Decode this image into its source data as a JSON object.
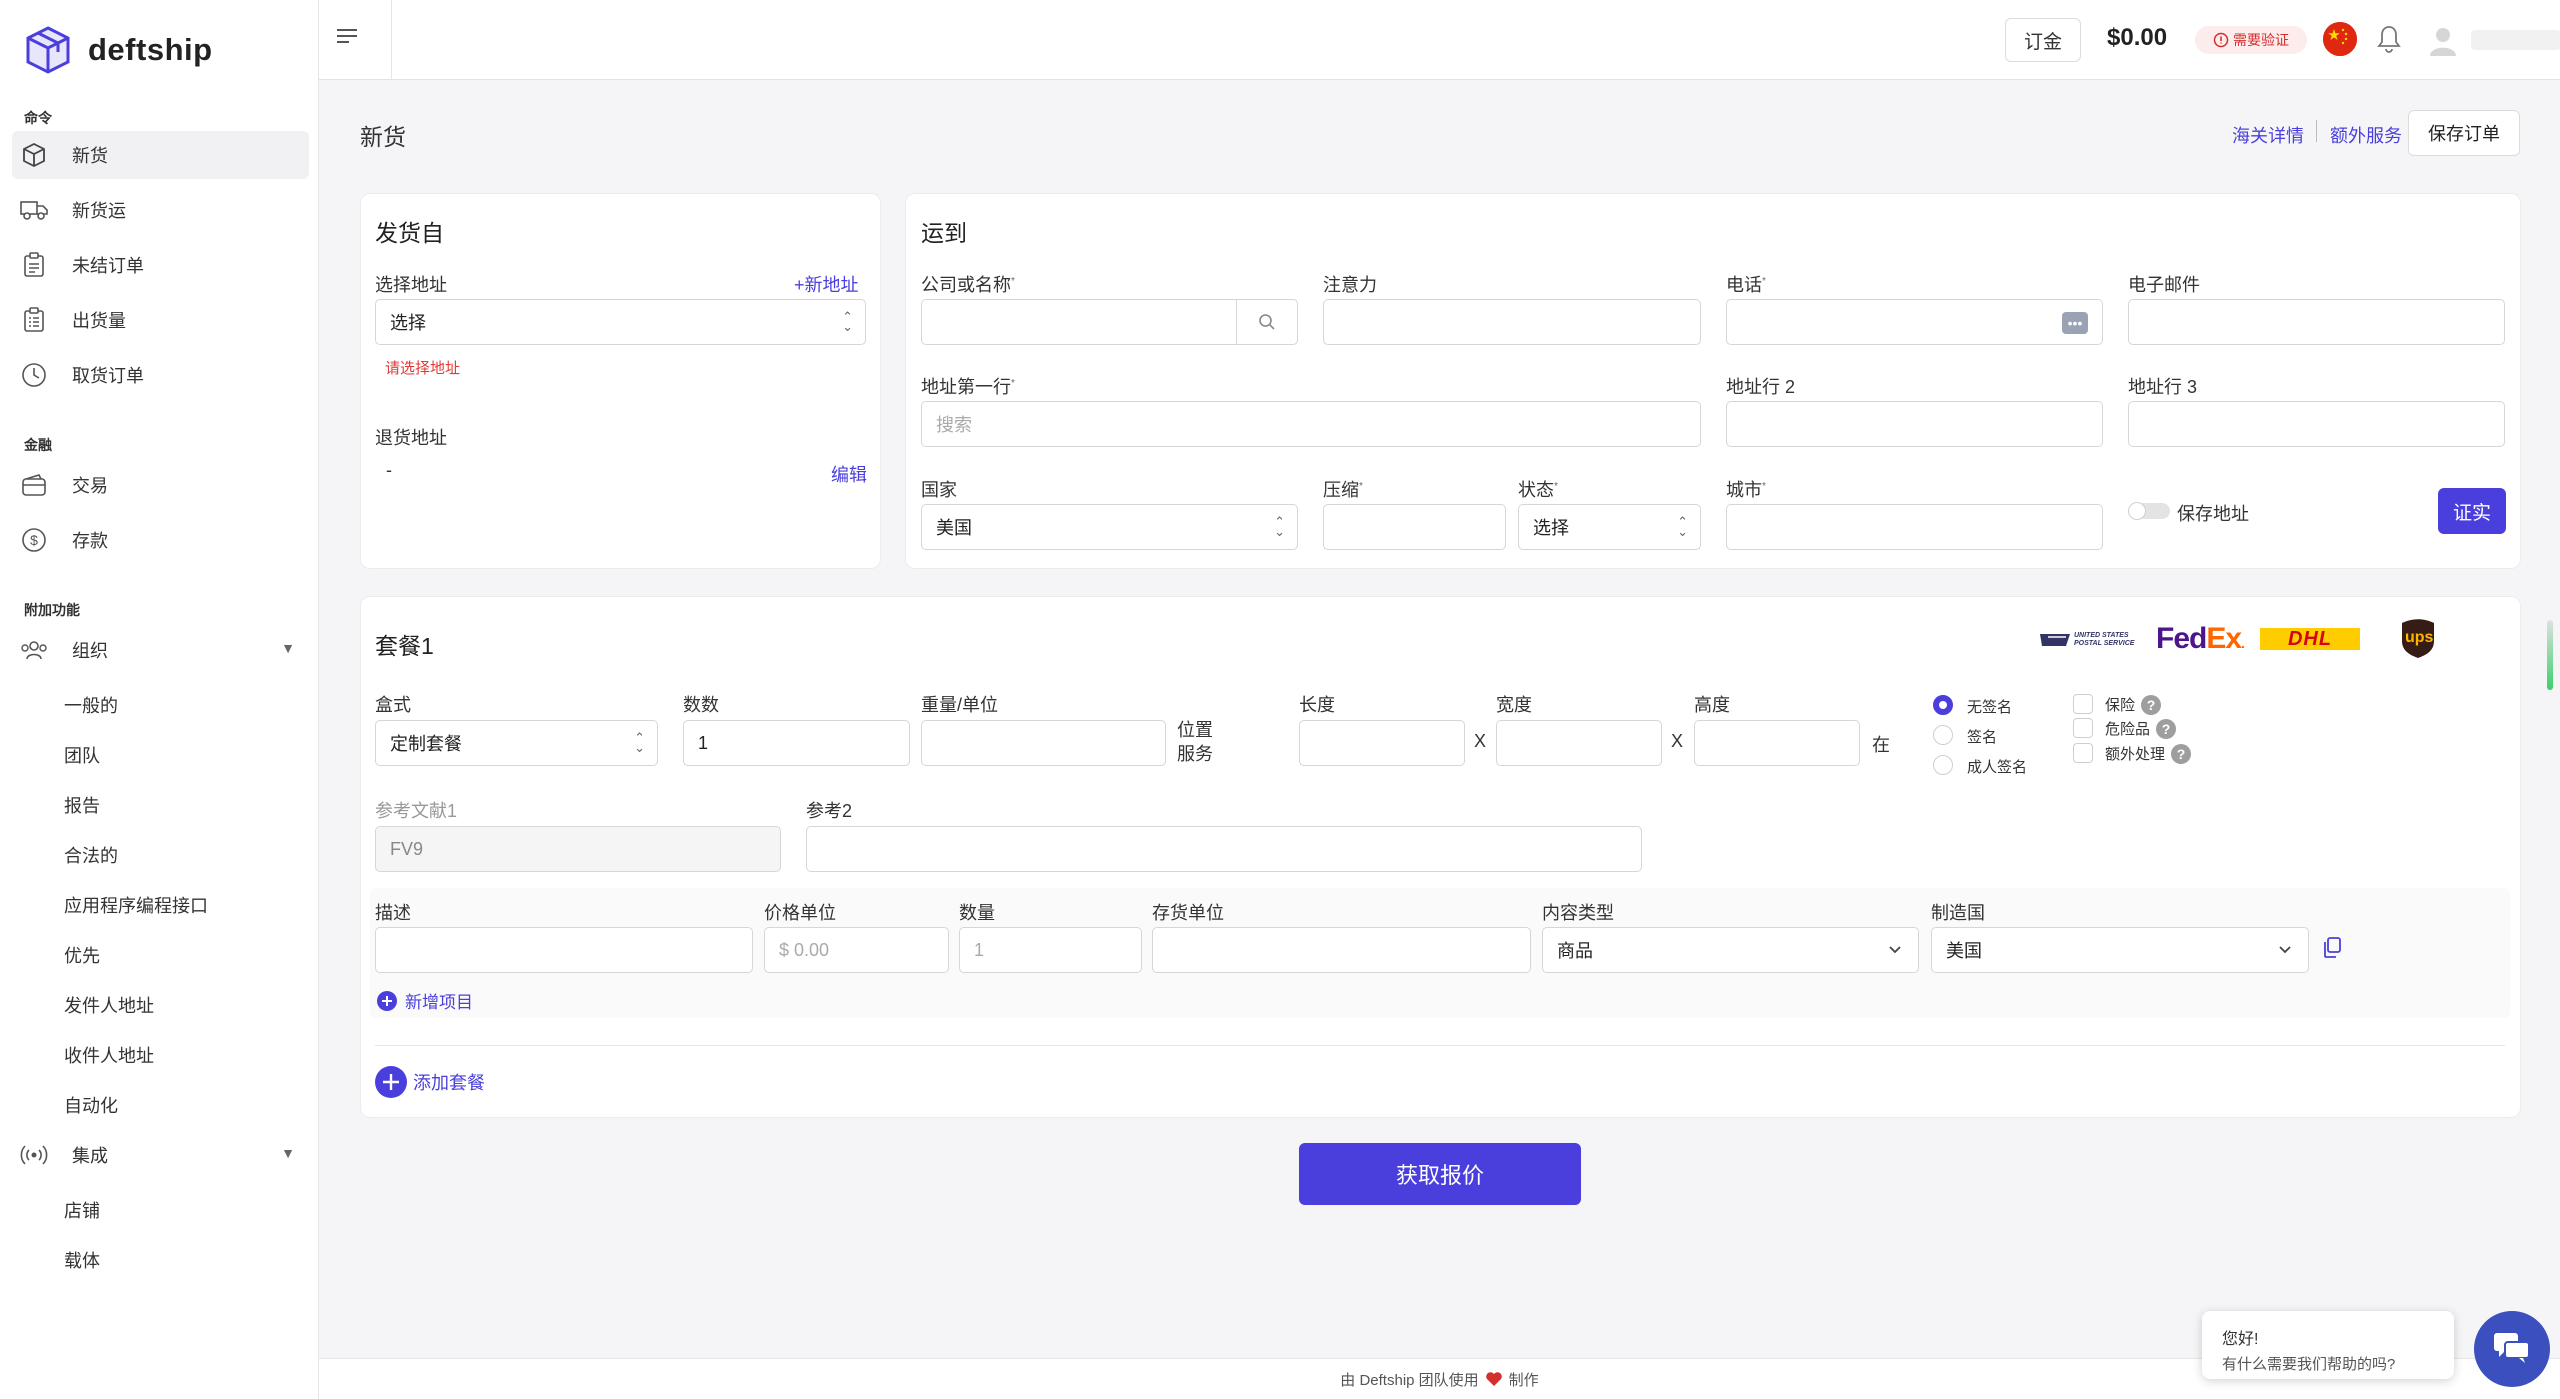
{
  "app": {
    "brand": "deftship"
  },
  "sidebar": {
    "sections": {
      "orders": "命令",
      "finance": "金融",
      "addons": "附加功能"
    },
    "orders": [
      {
        "label": "新货",
        "icon": "box-icon"
      },
      {
        "label": "新货运",
        "icon": "truck-icon"
      },
      {
        "label": "未结订单",
        "icon": "clipboard-icon"
      },
      {
        "label": "出货量",
        "icon": "clipboard-list-icon"
      },
      {
        "label": "取货订单",
        "icon": "clock-icon"
      }
    ],
    "finance": [
      {
        "label": "交易",
        "icon": "wallet-icon"
      },
      {
        "label": "存款",
        "icon": "dollar-circle-icon"
      }
    ],
    "organization": {
      "label": "组织",
      "icon": "users-icon"
    },
    "organization_items": [
      "一般的",
      "团队",
      "报告",
      "合法的",
      "应用程序编程接口",
      "优先",
      "发件人地址",
      "收件人地址",
      "自动化"
    ],
    "integrations": {
      "label": "集成",
      "icon": "broadcast-icon"
    },
    "integration_items": [
      "店铺",
      "载体"
    ]
  },
  "header": {
    "deposit_label": "订金",
    "balance": "$0.00",
    "verify_badge": "需要验证"
  },
  "page": {
    "title": "新货",
    "customs_link": "海关详情",
    "extra_services_link": "额外服务",
    "save_order": "保存订单"
  },
  "ship_from": {
    "title": "发货自",
    "select_address_label": "选择地址",
    "new_address": "+新地址",
    "select_value": "选择",
    "error": "请选择地址",
    "return_address_label": "退货地址",
    "return_address_value": "-",
    "edit": "编辑"
  },
  "ship_to": {
    "title": "运到",
    "company_label": "公司或名称",
    "attention_label": "注意力",
    "phone_label": "电话",
    "email_label": "电子邮件",
    "address1_label": "地址第一行",
    "address1_placeholder": "搜索",
    "address2_label": "地址行 2",
    "address3_label": "地址行 3",
    "country_label": "国家",
    "country_value": "美国",
    "zip_label": "压缩",
    "state_label": "状态",
    "state_value": "选择",
    "city_label": "城市",
    "save_address": "保存地址",
    "verify": "证实"
  },
  "package": {
    "title": "套餐1",
    "carriers": [
      "USPS",
      "FedEx",
      "DHL",
      "UPS"
    ],
    "usps_text": "UNITED STATES POSTAL SERVICE",
    "fedex_text_a": "Fed",
    "fedex_text_b": "Ex",
    "dhl_text": "DHL",
    "ups_text": "ups",
    "box_type_label": "盒式",
    "box_type_value": "定制套餐",
    "count_label": "数数",
    "count_value": "1",
    "weight_label": "重量/单位",
    "position_service": "位置服务",
    "length_label": "长度",
    "width_label": "宽度",
    "height_label": "高度",
    "x": "X",
    "unit_in": "在",
    "signature_options": [
      "无签名",
      "签名",
      "成人签名"
    ],
    "extras": [
      "保险",
      "危险品",
      "额外处理"
    ],
    "ref1_label": "参考文献1",
    "ref1_value": "FV9",
    "ref2_label": "参考2",
    "item": {
      "description_label": "描述",
      "price_label": "价格单位",
      "price_placeholder": "$ 0.00",
      "qty_label": "数量",
      "qty_placeholder": "1",
      "sku_label": "存货单位",
      "content_type_label": "内容类型",
      "content_type_value": "商品",
      "origin_label": "制造国",
      "origin_value": "美国"
    },
    "add_item": "新增项目",
    "add_package": "添加套餐"
  },
  "actions": {
    "get_quote": "获取报价"
  },
  "footer": {
    "text": "由 Deftship 团队使用",
    "made": "制作"
  },
  "chat": {
    "greeting": "您好!",
    "question": "有什么需要我们帮助的吗?"
  },
  "colors": {
    "accent": "#4a3fdc",
    "error": "#e53935",
    "fedex_purple": "#4d148c",
    "fedex_orange": "#ff6600",
    "dhl_yellow": "#ffcc00",
    "dhl_red": "#d40511",
    "ups_brown": "#351c15"
  }
}
